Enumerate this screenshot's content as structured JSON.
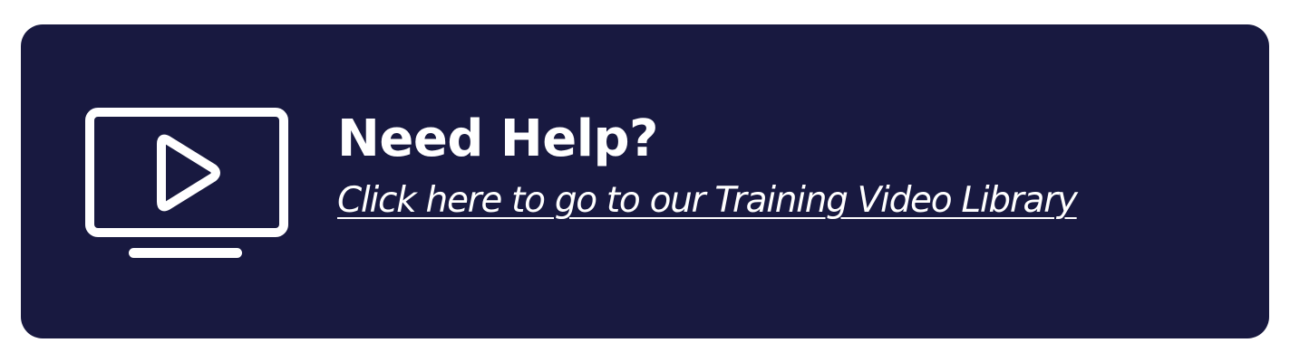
{
  "banner": {
    "background_color": "#181940",
    "text_color": "#ffffff",
    "icon": "video-monitor-play-icon",
    "heading": "Need Help?",
    "link_text": "Click here to go to our Training Video Library"
  }
}
